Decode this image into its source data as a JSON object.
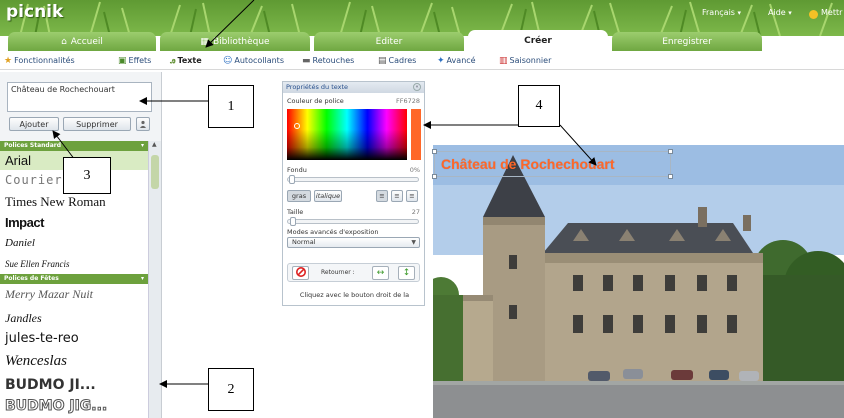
{
  "app": {
    "logo": "picnik"
  },
  "header_links": {
    "language": "Français",
    "help": "Aide",
    "account": "Mettr"
  },
  "main_tabs": [
    {
      "label": "Accueil",
      "icon": "home-icon"
    },
    {
      "label": "Bibliothèque",
      "icon": "library-icon"
    },
    {
      "label": "Editer",
      "icon": ""
    },
    {
      "label": "Créer",
      "icon": ""
    },
    {
      "label": "Enregistrer",
      "icon": ""
    }
  ],
  "sub_tabs": [
    {
      "label": "Fonctionnalités",
      "icon": "star-icon"
    },
    {
      "label": "Effets",
      "icon": "effects-icon"
    },
    {
      "label": "Texte",
      "icon": "text-icon"
    },
    {
      "label": "Autocollants",
      "icon": "sticker-icon"
    },
    {
      "label": "Retouches",
      "icon": "retouch-icon"
    },
    {
      "label": "Cadres",
      "icon": "frames-icon"
    },
    {
      "label": "Avancé",
      "icon": "advanced-icon"
    },
    {
      "label": "Saisonnier",
      "icon": "calendar-icon"
    }
  ],
  "text_panel": {
    "input_value": "Château de Rochechouart",
    "add_label": "Ajouter",
    "delete_label": "Supprimer"
  },
  "font_sections": {
    "standard": "Polices Standard",
    "festive": "Polices de Fêtes"
  },
  "fonts_standard": [
    "Arial",
    "Courier",
    "Times New Roman",
    "Impact",
    "Daniel",
    "Sue Ellen Francis"
  ],
  "fonts_festive": [
    "Merry Mazar Nuit",
    "Jandles",
    "jules-te-reo",
    "Wenceslas",
    "BUDMO JI...",
    "BUDMO JIG..."
  ],
  "properties": {
    "title": "Propriétés du texte",
    "color_label": "Couleur de police",
    "color_value": "FF6728",
    "fade_label": "Fondu",
    "fade_value": "0%",
    "bold_label": "gras",
    "italic_label": "italique",
    "size_label": "Taille",
    "size_value": "27",
    "blend_label": "Modes avancés d'exposition",
    "blend_value": "Normal",
    "flip_label": "Retourner :",
    "hint": "Cliquez avec le bouton droit de la"
  },
  "canvas_text": "Château de Rochechouart",
  "callouts": [
    "1",
    "2",
    "3",
    "4"
  ],
  "colors": {
    "accent_green": "#6da13d",
    "text_color": "#FF6728",
    "link_blue": "#2b4d7a"
  }
}
